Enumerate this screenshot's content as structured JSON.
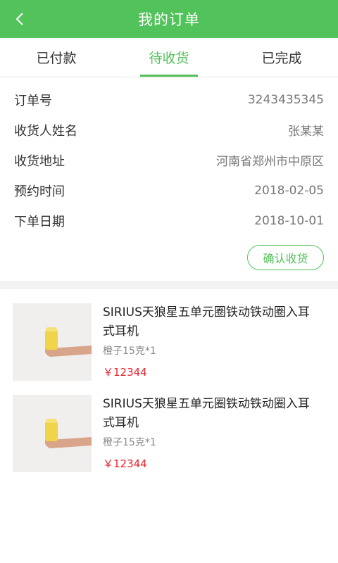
{
  "header": {
    "title": "我的订单"
  },
  "tabs": [
    {
      "label": "已付款"
    },
    {
      "label": "待收货"
    },
    {
      "label": "已完成"
    }
  ],
  "order": {
    "rows": [
      {
        "label": "订单号",
        "value": "3243435345"
      },
      {
        "label": "收货人姓名",
        "value": "张某某"
      },
      {
        "label": "收货地址",
        "value": "河南省郑州市中原区"
      },
      {
        "label": "预约时间",
        "value": "2018-02-05"
      },
      {
        "label": "下单日期",
        "value": "2018-10-01"
      }
    ],
    "confirm_label": "确认收货"
  },
  "products": [
    {
      "title": "SIRIUS天狼星五单元圈铁动铁动圈入耳式耳机",
      "spec": "橙子15克*1",
      "price": "￥12344"
    },
    {
      "title": "SIRIUS天狼星五单元圈铁动铁动圈入耳式耳机",
      "spec": "橙子15克*1",
      "price": "￥12344"
    }
  ],
  "colors": {
    "accent": "#52c25a",
    "price": "#e8232e"
  }
}
